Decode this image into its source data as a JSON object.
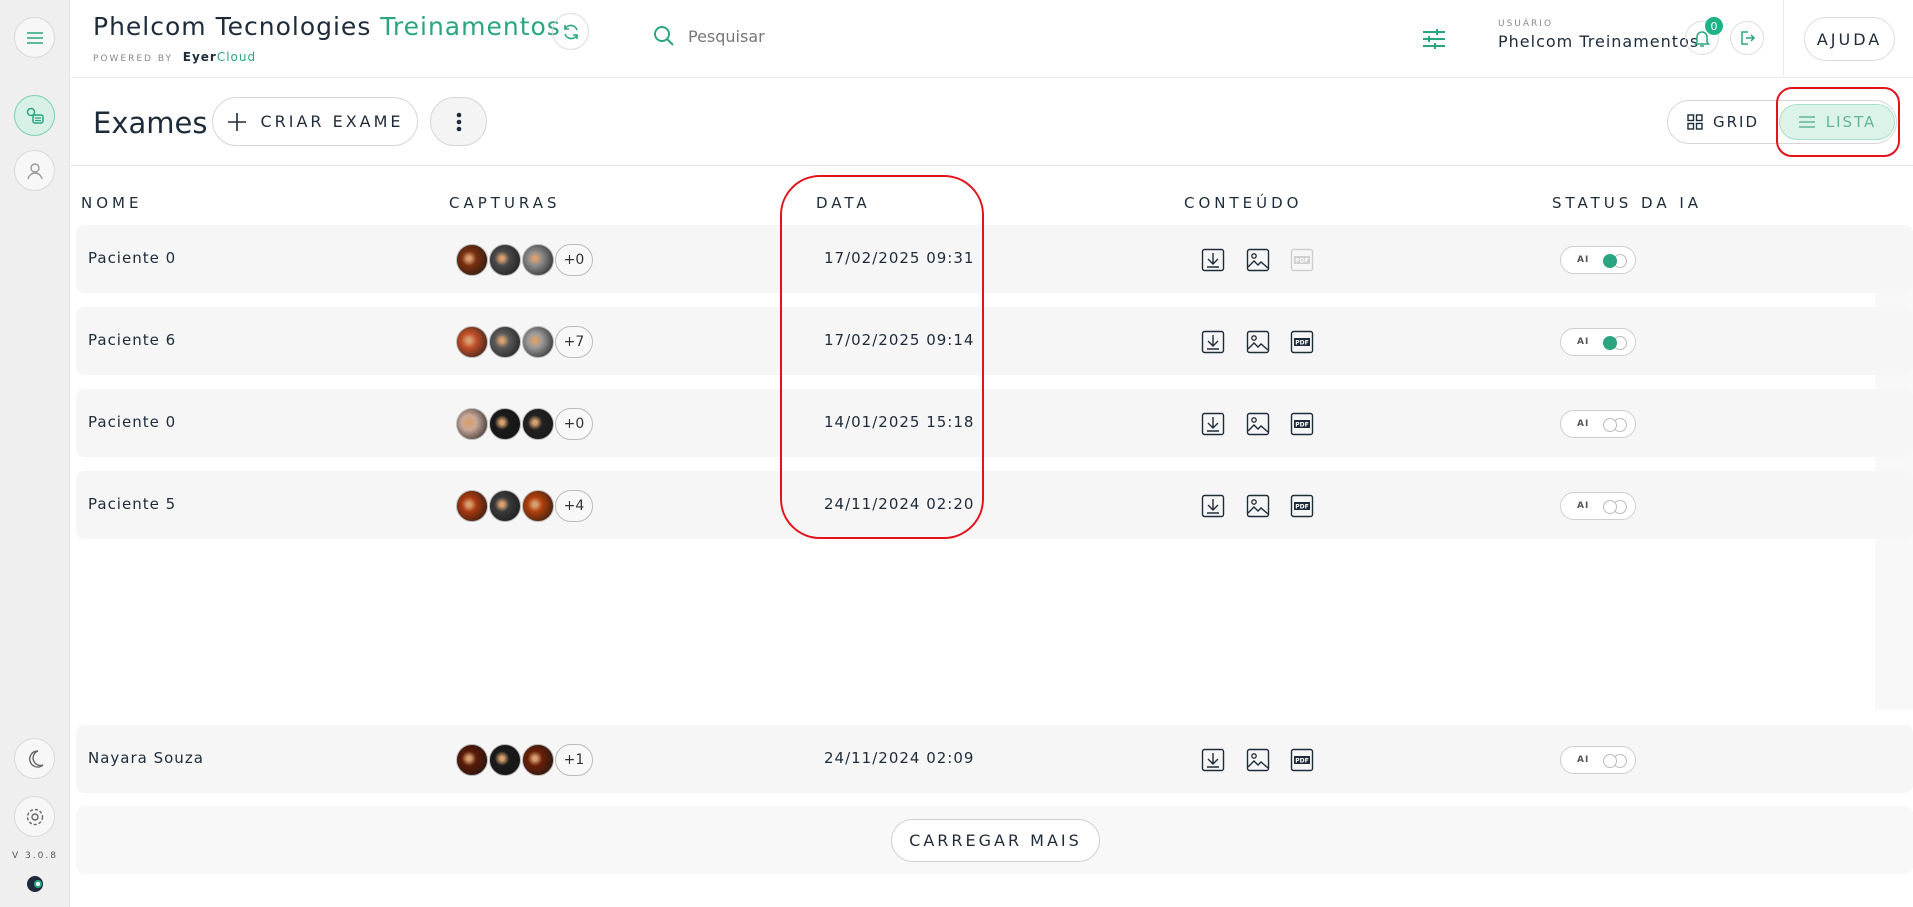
{
  "app": {
    "title_main": "Phelcom Tecnologies",
    "title_accent": "Treinamentos",
    "powered_by": "POWERED BY",
    "brand_part1": "Eyer",
    "brand_part2": "Cloud",
    "version": "V 3.0.8"
  },
  "search": {
    "placeholder": "Pesquisar"
  },
  "user": {
    "label": "USUÁRIO",
    "name": "Phelcom Treinamentos"
  },
  "notifications": {
    "count": "0"
  },
  "help": {
    "label": "AJUDA"
  },
  "page": {
    "title": "Exames"
  },
  "toolbar": {
    "create_label": "CRIAR EXAME",
    "grid_label": "GRID",
    "list_label": "LISTA"
  },
  "columns": {
    "name": "NOME",
    "captures": "CAPTURAS",
    "date": "DATA",
    "content": "CONTEÚDO",
    "ai_status": "STATUS DA IA"
  },
  "exams": [
    {
      "name": "Paciente 0",
      "date": "17/02/2025 09:31",
      "extra": "+0",
      "thumbs": [
        "#7a3010",
        "#4a4a4a",
        "#8a8a8a"
      ],
      "pdf_enabled": false,
      "ai_on": true,
      "ai_label": "AI"
    },
    {
      "name": "Paciente 6",
      "date": "17/02/2025 09:14",
      "extra": "+7",
      "thumbs": [
        "#c2502a",
        "#5a5a5a",
        "#9a9a9a"
      ],
      "pdf_enabled": true,
      "ai_on": true,
      "ai_label": "AI"
    },
    {
      "name": "Paciente 0",
      "date": "14/01/2025 15:18",
      "extra": "+0",
      "thumbs": [
        "#c9a99a",
        "#1a1a1a",
        "#222222"
      ],
      "pdf_enabled": true,
      "ai_on": false,
      "ai_label": "AI"
    },
    {
      "name": "Paciente 5",
      "date": "24/11/2024 02:20",
      "extra": "+4",
      "thumbs": [
        "#a83a10",
        "#3a3a3a",
        "#b0400c"
      ],
      "pdf_enabled": true,
      "ai_on": false,
      "ai_label": "AI"
    },
    {
      "name": "Nayara Souza",
      "date": "24/11/2024 02:09",
      "extra": "+1",
      "thumbs": [
        "#5a1a08",
        "#1a1a1a",
        "#6a2008"
      ],
      "pdf_enabled": true,
      "ai_on": false,
      "ai_label": "AI"
    }
  ],
  "load_more": {
    "label": "CARREGAR MAIS"
  },
  "colors": {
    "accent": "#2aa582",
    "annotation": "#e3131c"
  }
}
